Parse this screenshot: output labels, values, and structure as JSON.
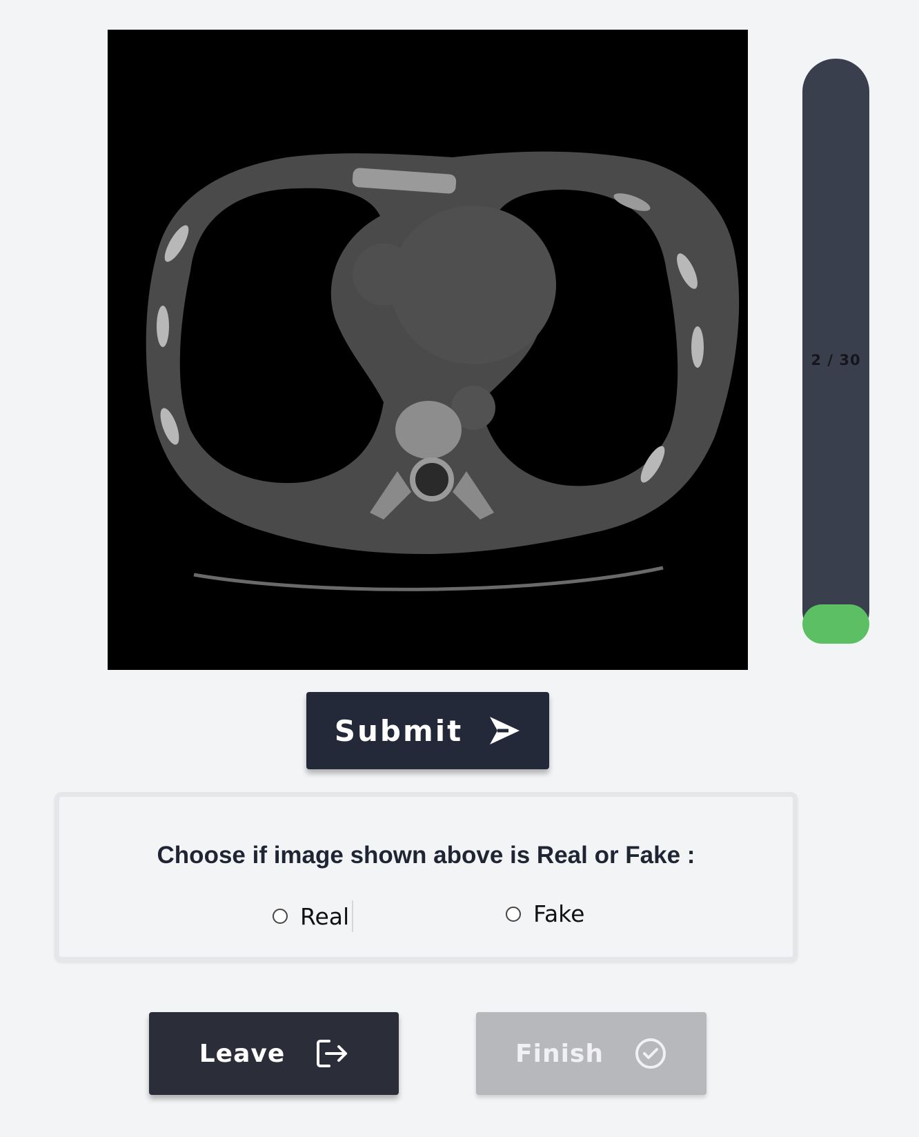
{
  "progress": {
    "label": "2 / 30",
    "current": 2,
    "total": 30,
    "fill_fraction": 0.0667,
    "track_color": "#3a3f4e",
    "fill_color": "#5cbf63"
  },
  "image": {
    "icon": "ct-scan-image"
  },
  "submit": {
    "label": "Submit",
    "icon": "send-arrow-icon"
  },
  "question": {
    "text": "Choose if image shown above is Real or Fake :",
    "options": [
      {
        "label": "Real",
        "selected": false
      },
      {
        "label": "Fake",
        "selected": false
      }
    ]
  },
  "actions": {
    "leave": {
      "label": "Leave",
      "icon": "logout-icon"
    },
    "finish": {
      "label": "Finish",
      "icon": "check-circle-icon",
      "disabled": true
    }
  },
  "colors": {
    "background": "#f3f4f6",
    "dark_button": "#232938",
    "disabled_button": "#b7b8bc"
  }
}
